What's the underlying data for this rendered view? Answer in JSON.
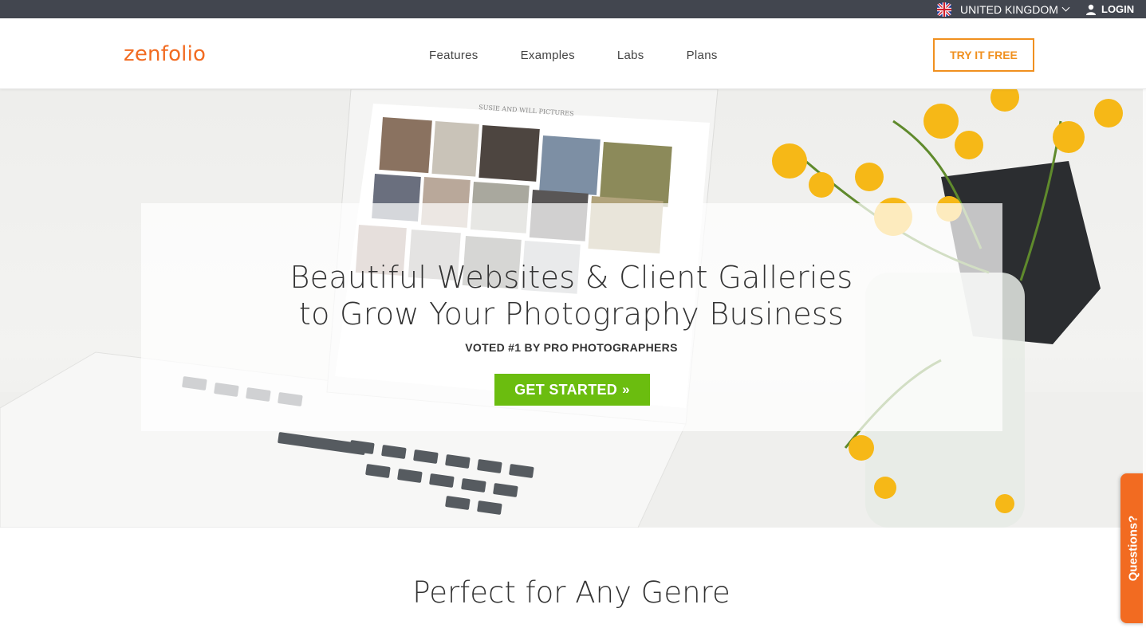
{
  "topbar": {
    "region_label": "UNITED KINGDOM",
    "region_icon": "uk-flag-icon",
    "login_label": "LOGIN",
    "login_icon": "user-icon"
  },
  "header": {
    "logo": "zenfolio",
    "nav": [
      "Features",
      "Examples",
      "Labs",
      "Plans"
    ],
    "try_label": "TRY IT FREE"
  },
  "hero": {
    "title_line1": "Beautiful Websites & Client Galleries",
    "title_line2": "to Grow Your Photography Business",
    "subtitle": "VOTED #1 BY PRO PHOTOGRAPHERS",
    "cta_label": "GET STARTED",
    "cta_arrow": "»",
    "laptop_site_title": "SUSIE AND WILL PICTURES"
  },
  "section": {
    "title": "Perfect for Any Genre"
  },
  "questions_tab": "Questions?",
  "colors": {
    "brand_orange": "#f26b21",
    "try_orange": "#f0901f",
    "cta_green": "#6bbd0f",
    "topbar": "#42464f"
  }
}
